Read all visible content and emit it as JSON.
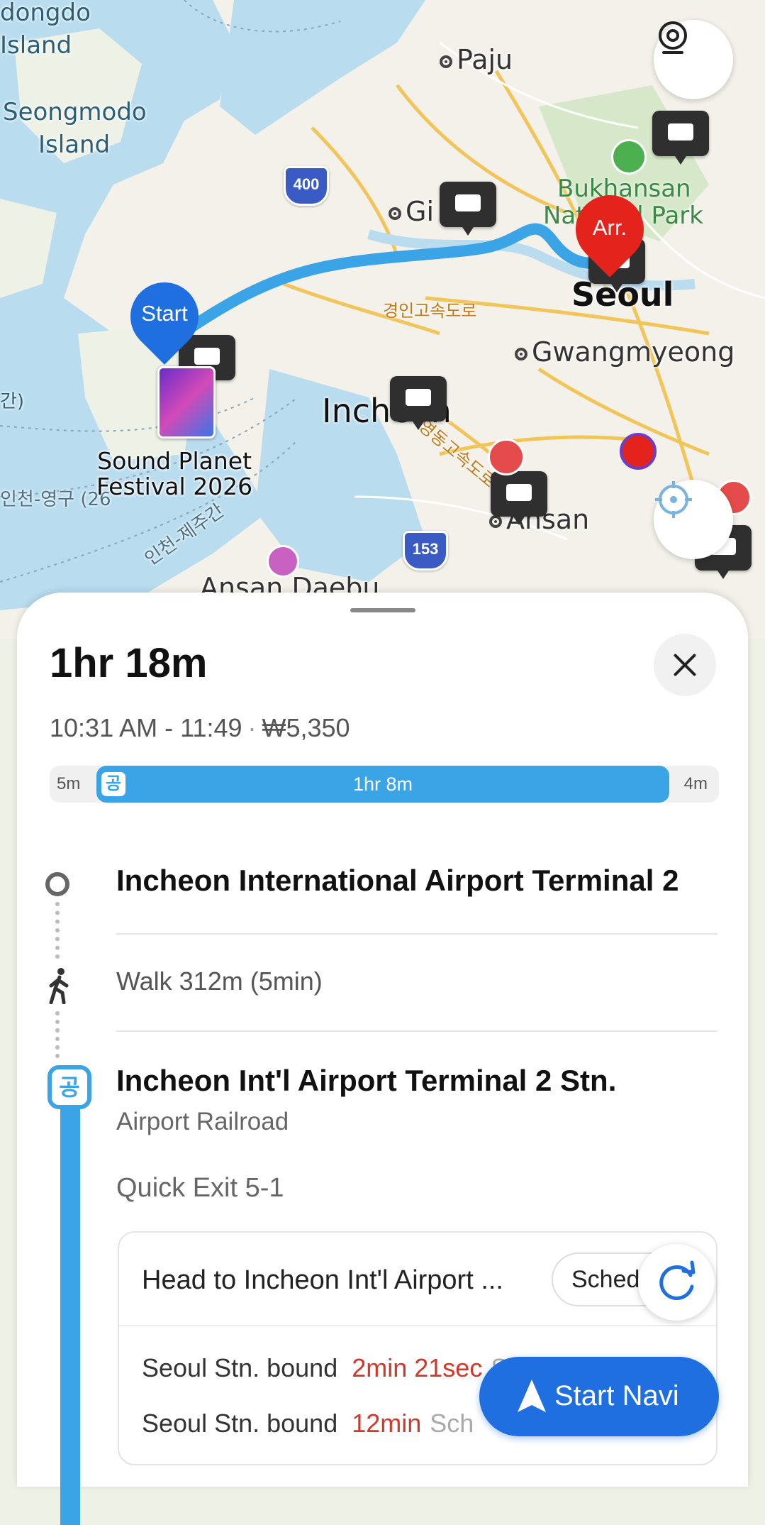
{
  "map": {
    "labels": {
      "dongdo": "dongdo",
      "island": "Island",
      "seongmodo": "Seongmodo",
      "seongmodo_island": "Island",
      "paju": "Paju",
      "gimpo": "Gi",
      "bukhansan1": "Bukhansan",
      "bukhansan2": "National Park",
      "seoul": "Seoul",
      "gwangmyeong": "Gwangmyeong",
      "incheon": "Incheon",
      "ansan": "Ansan",
      "ansan_daebu": "Ansan Daebu",
      "expressway_kr": "경인고속도로",
      "coast_kr": "인천-영구 (26",
      "incheon_jeju": "인천-제주간",
      "route_kr": "영동고속도로",
      "festival": "Sound Planet\nFestival 2026",
      "left_edge": "간)"
    },
    "highways": [
      "400",
      "153"
    ],
    "start_pin": "Start",
    "arrival_pin": "Arr."
  },
  "route": {
    "total_time": "1hr 18m",
    "depart_arrive": "10:31 AM - 11:49",
    "fare": "₩5,350",
    "bar": {
      "walk_start": "5m",
      "transit": "1hr 8m",
      "walk_end": "4m",
      "badge": "공"
    },
    "origin": "Incheon International Airport Terminal 2",
    "walk": "Walk 312m (5min)",
    "station": {
      "badge": "공",
      "name": "Incheon Int'l Airport Terminal 2 Stn.",
      "line": "Airport Railroad",
      "quick_exit": "Quick Exit 5-1",
      "direction": "Head to Incheon Int'l Airport ...",
      "sched_label": "Sched",
      "trains": [
        {
          "dest": "Seoul Stn. bound",
          "mins": "2min 21sec",
          "status": "Schedule"
        },
        {
          "dest": "Seoul Stn. bound",
          "mins": "12min",
          "status": "Sch"
        }
      ]
    }
  },
  "buttons": {
    "start_navi": "Start Navi"
  },
  "colors": {
    "route_blue": "#3ba4e6",
    "primary": "#1f6fe0",
    "arrival_red": "#e4231d",
    "time_red": "#d2372a"
  }
}
